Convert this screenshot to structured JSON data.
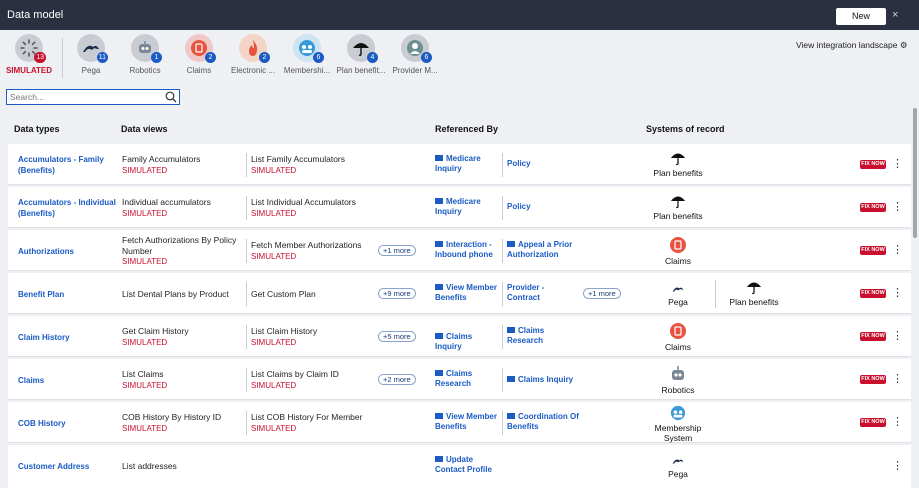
{
  "header": {
    "title": "Data model",
    "new_label": "New",
    "close_icon": "×"
  },
  "sources": [
    {
      "label": "SIMULATED",
      "count": "13",
      "icon": "spinner-icon"
    },
    {
      "label": "Pega",
      "count": "11",
      "icon": "pega-icon"
    },
    {
      "label": "Robotics",
      "count": "1",
      "icon": "robot-icon"
    },
    {
      "label": "Claims",
      "count": "2",
      "icon": "claims-icon"
    },
    {
      "label": "Electronic ...",
      "count": "2",
      "icon": "fire-icon"
    },
    {
      "label": "Membershi...",
      "count": "6",
      "icon": "membership-icon"
    },
    {
      "label": "Plan benefit...",
      "count": "4",
      "icon": "umbrella-icon"
    },
    {
      "label": "Provider M...",
      "count": "6",
      "icon": "provider-icon"
    }
  ],
  "view_integration": "View integration landscape",
  "search": {
    "placeholder": "Search..."
  },
  "columns": {
    "data_types": "Data types",
    "data_views": "Data views",
    "referenced_by": "Referenced By",
    "systems": "Systems of record"
  },
  "fix_now": "FIX NOW",
  "rows": [
    {
      "type": "Accumulators - Family (Benefits)",
      "dv1": "Family Accumulators",
      "dv1_sim": "SIMULATED",
      "dv2": "List Family Accumulators",
      "dv2_sim": "SIMULATED",
      "more": "",
      "ref1": "Medicare Inquiry",
      "ref2": "Policy",
      "ref_more": "",
      "sys1": "Plan benefits",
      "sys2": ""
    },
    {
      "type": "Accumulators - Individual (Benefits)",
      "dv1": "Individual accumulators",
      "dv1_sim": "SIMULATED",
      "dv2": "List Individual Accumulators",
      "dv2_sim": "SIMULATED",
      "more": "",
      "ref1": "Medicare Inquiry",
      "ref2": "Policy",
      "ref_more": "",
      "sys1": "Plan benefits",
      "sys2": ""
    },
    {
      "type": "Authorizations",
      "dv1": "Fetch Authorizations By Policy Number",
      "dv1_sim": "SIMULATED",
      "dv2": "Fetch Member Authorizations",
      "dv2_sim": "SIMULATED",
      "more": "+1 more",
      "ref1": "Interaction - Inbound phone",
      "ref2": "Appeal a Prior Authorization",
      "ref_more": "",
      "sys1": "Claims",
      "sys2": ""
    },
    {
      "type": "Benefit Plan",
      "dv1": "List Dental Plans by Product",
      "dv1_sim": "",
      "dv2": "Get Custom Plan",
      "dv2_sim": "",
      "more": "+9 more",
      "ref1": "View Member Benefits",
      "ref2": "Provider - Contract",
      "ref_more": "+1 more",
      "sys1": "Pega",
      "sys2": "Plan benefits"
    },
    {
      "type": "Claim History",
      "dv1": "Get Claim History",
      "dv1_sim": "SIMULATED",
      "dv2": "List Claim History",
      "dv2_sim": "SIMULATED",
      "more": "+5 more",
      "ref1": "Claims Inquiry",
      "ref2": "Claims Research",
      "ref_more": "",
      "sys1": "Claims",
      "sys2": ""
    },
    {
      "type": "Claims",
      "dv1": "List Claims",
      "dv1_sim": "SIMULATED",
      "dv2": "List Claims by Claim ID",
      "dv2_sim": "SIMULATED",
      "more": "+2 more",
      "ref1": "Claims Research",
      "ref2": "Claims Inquiry",
      "ref_more": "",
      "sys1": "Robotics",
      "sys2": ""
    },
    {
      "type": "COB History",
      "dv1": "COB History By History ID",
      "dv1_sim": "SIMULATED",
      "dv2": "List COB History For Member",
      "dv2_sim": "SIMULATED",
      "more": "",
      "ref1": "View Member Benefits",
      "ref2": "Coordination Of Benefits",
      "ref_more": "",
      "sys1": "Membership System",
      "sys2": ""
    },
    {
      "type": "Customer Address",
      "dv1": "List addresses",
      "dv1_sim": "",
      "dv2": "",
      "dv2_sim": "",
      "more": "",
      "ref1": "Update Contact Profile",
      "ref2": "",
      "ref_more": "",
      "sys1": "Pega",
      "sys2": ""
    }
  ]
}
